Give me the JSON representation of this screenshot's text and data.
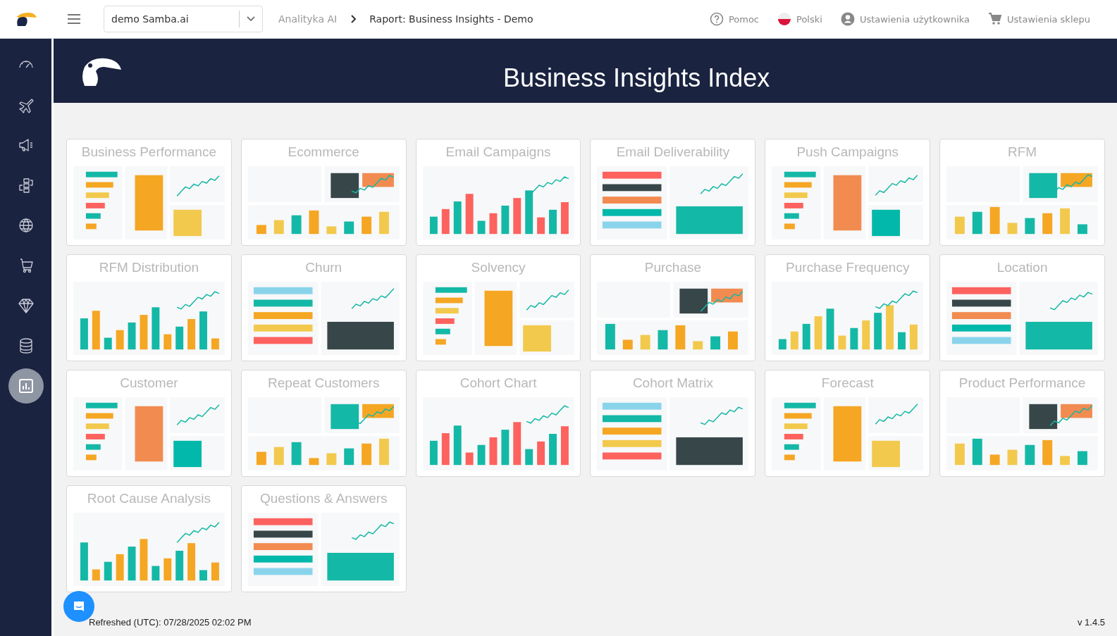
{
  "topbar": {
    "account_select": {
      "value": "demo Samba.ai"
    },
    "breadcrumb": [
      "Analityka AI",
      "Raport: Business Insights - Demo"
    ],
    "links": [
      {
        "label": "Pomoc"
      },
      {
        "label": "Polski"
      },
      {
        "label": "Ustawienia użytkownika"
      },
      {
        "label": "Ustawienia sklepu"
      }
    ]
  },
  "sidebar": {
    "items": [
      {
        "selected": false
      },
      {
        "selected": false
      },
      {
        "selected": false
      },
      {
        "selected": false
      },
      {
        "selected": false
      },
      {
        "selected": false
      },
      {
        "selected": false
      },
      {
        "selected": false
      },
      {
        "selected": true
      }
    ]
  },
  "banner": {
    "title": "Business Insights Index"
  },
  "reports": [
    {
      "title": "Business Performance",
      "kind": "picture"
    },
    {
      "title": "Ecommerce",
      "kind": "picture"
    },
    {
      "title": "Email Campaigns",
      "kind": "picture"
    },
    {
      "title": "Email Deliverability",
      "kind": "picture"
    },
    {
      "title": "Push Campaigns",
      "kind": "picture"
    },
    {
      "title": "RFM",
      "kind": "picture"
    },
    {
      "title": "RFM Distribution",
      "kind": "picture"
    },
    {
      "title": "Churn",
      "kind": "picture"
    },
    {
      "title": "Solvency",
      "kind": "picture"
    },
    {
      "title": "Purchase",
      "kind": "picture"
    },
    {
      "title": "Purchase Frequency",
      "kind": "picture"
    },
    {
      "title": "Location",
      "kind": "picture"
    },
    {
      "title": "Customer",
      "kind": "picture"
    },
    {
      "title": "Repeat Customers",
      "kind": "picture"
    },
    {
      "title": "Cohort Chart",
      "kind": "picture"
    },
    {
      "title": "Cohort Matrix",
      "kind": "picture"
    },
    {
      "title": "Forecast",
      "kind": "picture"
    },
    {
      "title": "Product Performance",
      "kind": "picture"
    },
    {
      "title": "Root Cause Analysis",
      "kind": "picture"
    },
    {
      "title": "Questions & Answers",
      "kind": "picture"
    }
  ],
  "footer": {
    "refreshed": "Refreshed (UTC): 07/28/2025 02:02 PM",
    "version": "v 1.4.5"
  }
}
